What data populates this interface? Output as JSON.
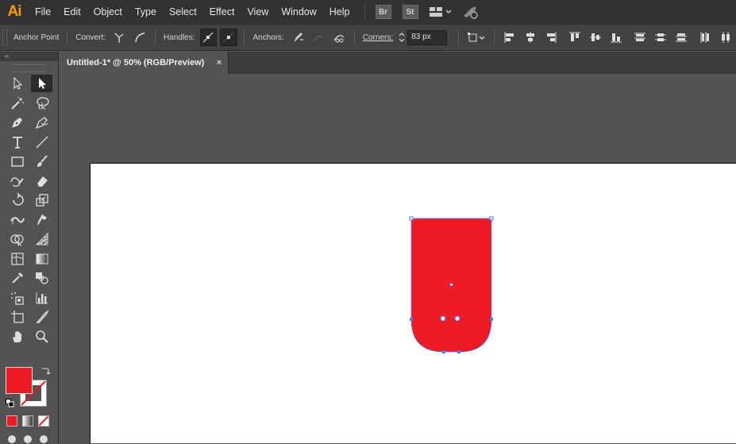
{
  "app": {
    "logo": "Ai",
    "accent": "#ff9a00"
  },
  "menu": [
    "File",
    "Edit",
    "Object",
    "Type",
    "Select",
    "Effect",
    "View",
    "Window",
    "Help"
  ],
  "toolbar_apps": {
    "bridge": "Br",
    "stock": "St"
  },
  "control": {
    "anchor_point": "Anchor Point",
    "convert": "Convert:",
    "handles": "Handles:",
    "anchors": "Anchors:",
    "corners": "Corners:",
    "corners_value": "83 px"
  },
  "document": {
    "tab_title": "Untitled-1* @ 50% (RGB/Preview)",
    "close": "×"
  },
  "colors": {
    "fill": "#ed1c24",
    "stroke": "none",
    "selection": "#4b7bff"
  },
  "icons": [
    "selection-tool-icon",
    "direct-selection-tool-icon",
    "magic-wand-icon",
    "lasso-icon",
    "pen-tool-icon",
    "curvature-tool-icon",
    "type-tool-icon",
    "line-tool-icon",
    "rectangle-tool-icon",
    "paintbrush-icon",
    "shaper-tool-icon",
    "eraser-icon",
    "rotate-tool-icon",
    "scale-tool-icon",
    "width-tool-icon",
    "puppet-warp-icon",
    "shape-builder-icon",
    "perspective-grid-icon",
    "mesh-tool-icon",
    "gradient-tool-icon",
    "eyedropper-icon",
    "blend-tool-icon",
    "symbol-sprayer-icon",
    "column-graph-icon",
    "artboard-tool-icon",
    "slice-tool-icon",
    "hand-tool-icon",
    "zoom-tool-icon"
  ]
}
